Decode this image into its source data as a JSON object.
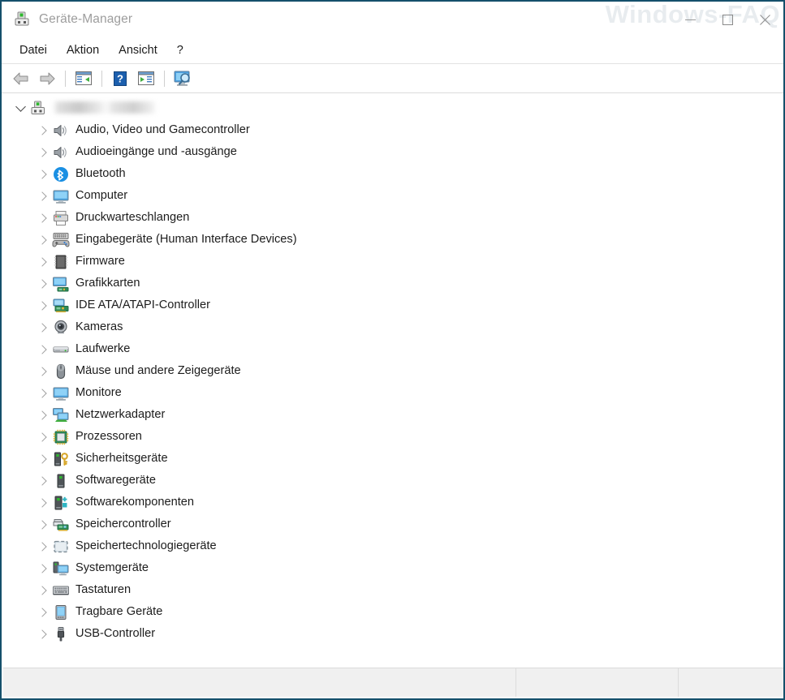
{
  "window": {
    "title": "Geräte-Manager",
    "title_icon": "device-manager-icon",
    "watermark": "Windows-FAQ",
    "border_color": "#15506b",
    "title_color": "#9d9d9d",
    "controls": [
      {
        "name": "minimize",
        "label": "—"
      },
      {
        "name": "maximize",
        "label": "▢"
      },
      {
        "name": "close",
        "label": "✕"
      }
    ]
  },
  "menubar": {
    "items": [
      {
        "label": "Datei"
      },
      {
        "label": "Aktion"
      },
      {
        "label": "Ansicht"
      },
      {
        "label": "?"
      }
    ]
  },
  "toolbar": {
    "buttons": [
      {
        "icon": "back-arrow-icon",
        "label": "Zurück"
      },
      {
        "icon": "forward-arrow-icon",
        "label": "Vorwärts"
      },
      {
        "icon": "show-hide-console-tree-icon",
        "label": "Konsolenstruktur ein-/ausblenden"
      },
      {
        "icon": "help-icon",
        "label": "Hilfe"
      },
      {
        "icon": "properties-icon",
        "label": "Eigenschaften"
      },
      {
        "icon": "scan-hardware-changes-icon",
        "label": "Nach geänderter Hardware suchen"
      }
    ]
  },
  "tree": {
    "root": {
      "label": "",
      "label_redacted": true,
      "icon": "computer-root-icon",
      "expanded": true
    },
    "items": [
      {
        "label": "Audio, Video und Gamecontroller",
        "icon": "speaker-icon",
        "expanded": false
      },
      {
        "label": "Audioeingänge und -ausgänge",
        "icon": "speaker-icon",
        "expanded": false
      },
      {
        "label": "Bluetooth",
        "icon": "bluetooth-icon",
        "expanded": false
      },
      {
        "label": "Computer",
        "icon": "monitor-icon",
        "expanded": false
      },
      {
        "label": "Druckwarteschlangen",
        "icon": "printer-icon",
        "expanded": false
      },
      {
        "label": "Eingabegeräte (Human Interface Devices)",
        "icon": "hid-keyboard-gamepad-icon",
        "expanded": false
      },
      {
        "label": "Firmware",
        "icon": "firmware-chip-icon",
        "expanded": false
      },
      {
        "label": "Grafikkarten",
        "icon": "display-adapter-icon",
        "expanded": false
      },
      {
        "label": "IDE ATA/ATAPI-Controller",
        "icon": "ide-controller-icon",
        "expanded": false
      },
      {
        "label": "Kameras",
        "icon": "camera-icon",
        "expanded": false
      },
      {
        "label": "Laufwerke",
        "icon": "disk-drive-icon",
        "expanded": false
      },
      {
        "label": "Mäuse und andere Zeigegeräte",
        "icon": "mouse-icon",
        "expanded": false
      },
      {
        "label": "Monitore",
        "icon": "monitor-icon",
        "expanded": false
      },
      {
        "label": "Netzwerkadapter",
        "icon": "network-adapter-icon",
        "expanded": false
      },
      {
        "label": "Prozessoren",
        "icon": "cpu-icon",
        "expanded": false
      },
      {
        "label": "Sicherheitsgeräte",
        "icon": "security-device-key-icon",
        "expanded": false
      },
      {
        "label": "Softwaregeräte",
        "icon": "software-device-icon",
        "expanded": false
      },
      {
        "label": "Softwarekomponenten",
        "icon": "software-component-icon",
        "expanded": false
      },
      {
        "label": "Speichercontroller",
        "icon": "storage-controller-icon",
        "expanded": false
      },
      {
        "label": "Speichertechnologiegeräte",
        "icon": "storage-technology-icon",
        "expanded": false
      },
      {
        "label": "Systemgeräte",
        "icon": "system-device-icon",
        "expanded": false
      },
      {
        "label": "Tastaturen",
        "icon": "keyboard-icon",
        "expanded": false
      },
      {
        "label": "Tragbare Geräte",
        "icon": "portable-device-icon",
        "expanded": false
      },
      {
        "label": "USB-Controller",
        "icon": "usb-icon",
        "expanded": false
      }
    ]
  },
  "statusbar": {
    "pane1": "",
    "pane2": "",
    "pane3": ""
  }
}
